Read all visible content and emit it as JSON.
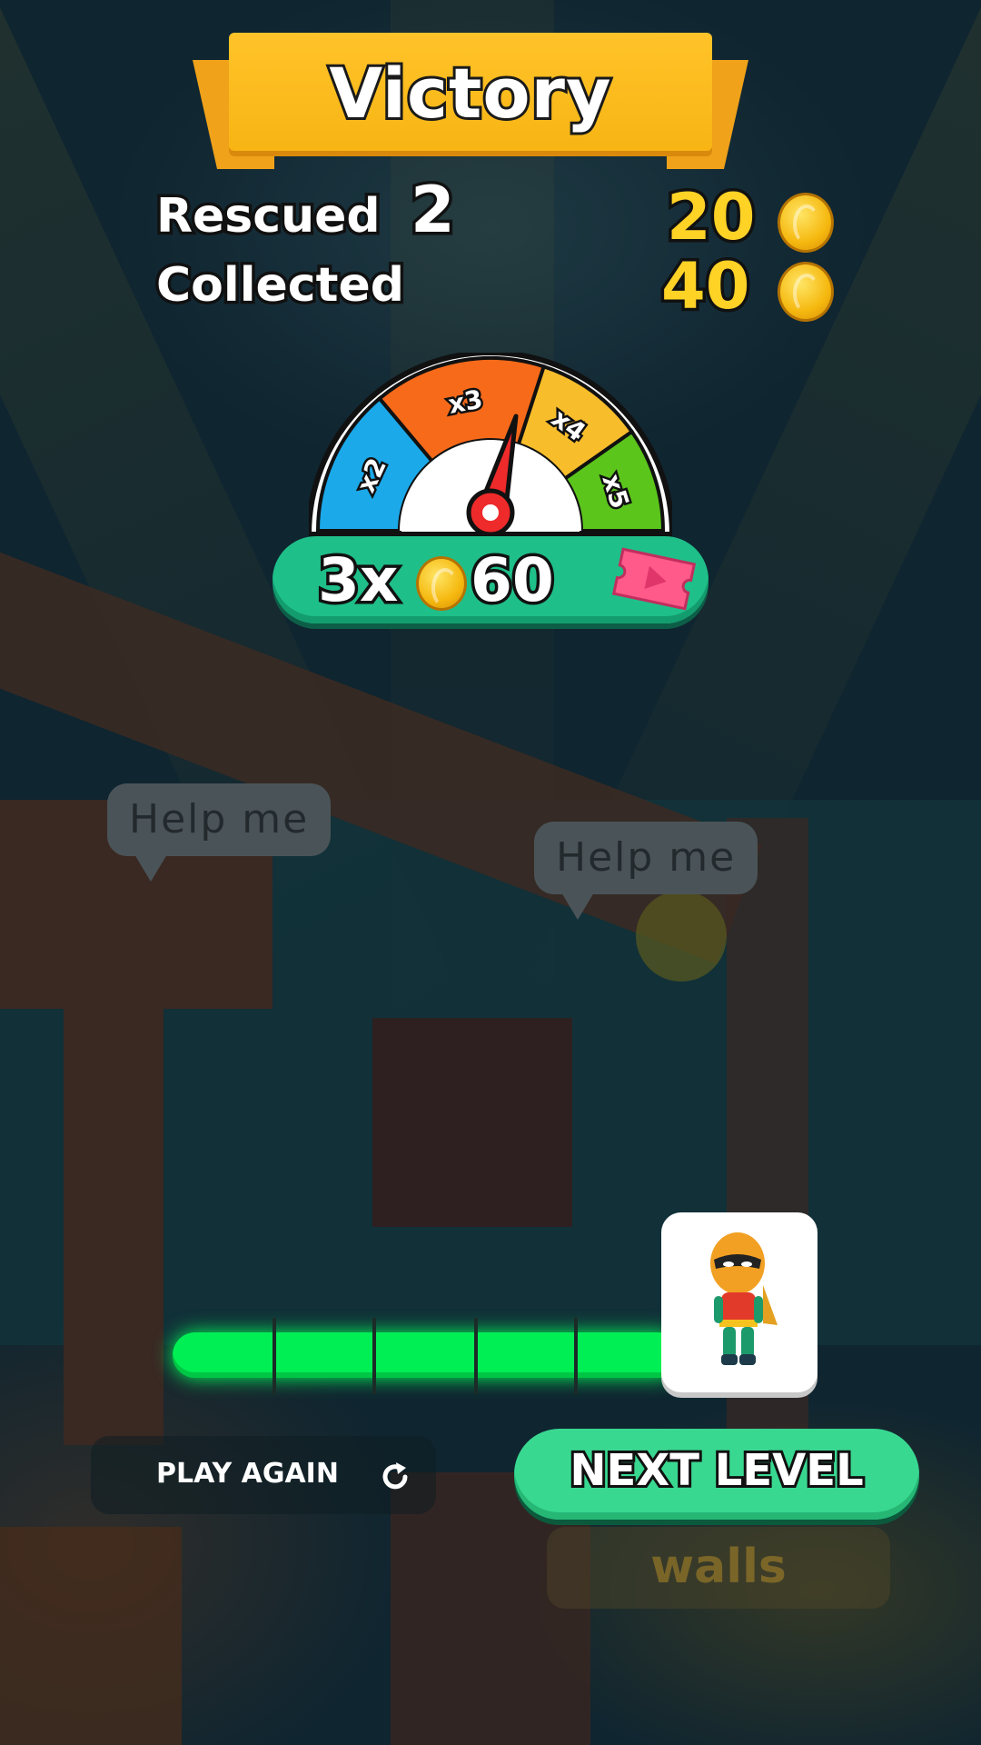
{
  "banner": {
    "title": "Victory"
  },
  "stats": {
    "rescued": {
      "label": "Rescued",
      "count": "2",
      "coins": "20"
    },
    "collected": {
      "label": "Collected",
      "coins": "40"
    }
  },
  "multiplier_gauge": {
    "segments": [
      "x2",
      "x3",
      "x4",
      "x5"
    ],
    "segment_colors": [
      "#1ba9ea",
      "#f66a1a",
      "#f8bd2b",
      "#5bc51c"
    ],
    "selected": "x3"
  },
  "reward": {
    "multiplier": "3x",
    "amount": "60",
    "icon": "ad-ticket-icon"
  },
  "progress": {
    "value": 1.0,
    "segments": 5
  },
  "world": {
    "bubbles": [
      "Help me",
      "Help me"
    ],
    "hint": "walls"
  },
  "buttons": {
    "play_again": "PLAY AGAIN",
    "next_level": "NEXT LEVEL"
  },
  "colors": {
    "accent_green": "#39d891",
    "gold": "#ffd226",
    "banner": "#ffc329"
  }
}
